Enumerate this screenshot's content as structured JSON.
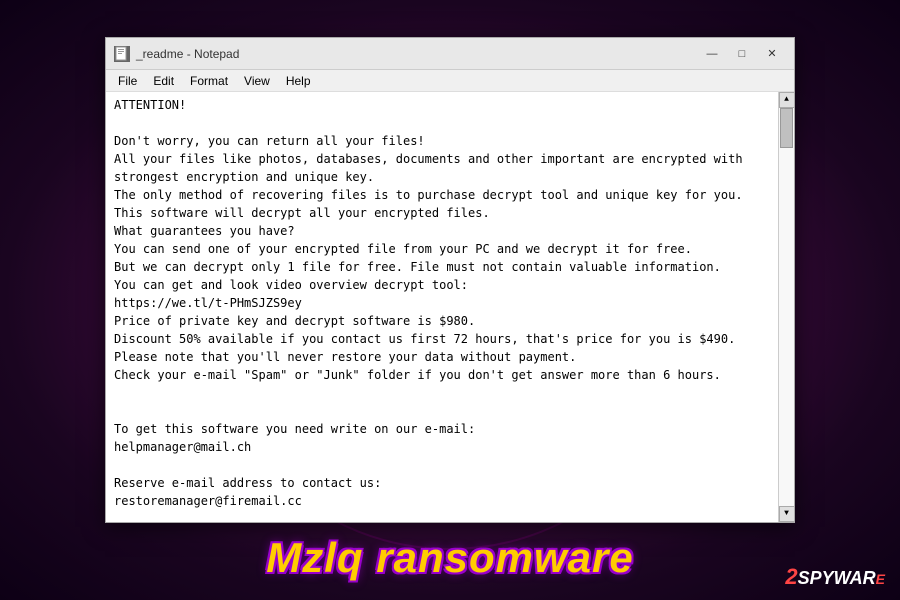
{
  "background": {
    "circles": [
      "circle1",
      "circle2"
    ]
  },
  "window": {
    "title": "_readme - Notepad",
    "icon_alt": "notepad-icon",
    "controls": {
      "minimize": "—",
      "maximize": "□",
      "close": "✕"
    }
  },
  "menubar": {
    "items": [
      "File",
      "Edit",
      "Format",
      "View",
      "Help"
    ]
  },
  "content": "ATTENTION!\n\nDon't worry, you can return all your files!\nAll your files like photos, databases, documents and other important are encrypted with\nstrongest encryption and unique key.\nThe only method of recovering files is to purchase decrypt tool and unique key for you.\nThis software will decrypt all your encrypted files.\nWhat guarantees you have?\nYou can send one of your encrypted file from your PC and we decrypt it for free.\nBut we can decrypt only 1 file for free. File must not contain valuable information.\nYou can get and look video overview decrypt tool:\nhttps://we.tl/t-PHmSJZS9ey\nPrice of private key and decrypt software is $980.\nDiscount 50% available if you contact us first 72 hours, that's price for you is $490.\nPlease note that you'll never restore your data without payment.\nCheck your e-mail \"Spam\" or \"Junk\" folder if you don't get answer more than 6 hours.\n\n\nTo get this software you need write on our e-mail:\nhelpmanager@mail.ch\n\nReserve e-mail address to contact us:\nrestoremanager@firemail.cc\n\nYour personal ID:",
  "bottom": {
    "title": "Mzlq ransomware",
    "logo": {
      "prefix": "2",
      "main": "SPYWAR",
      "suffix": "E"
    }
  }
}
